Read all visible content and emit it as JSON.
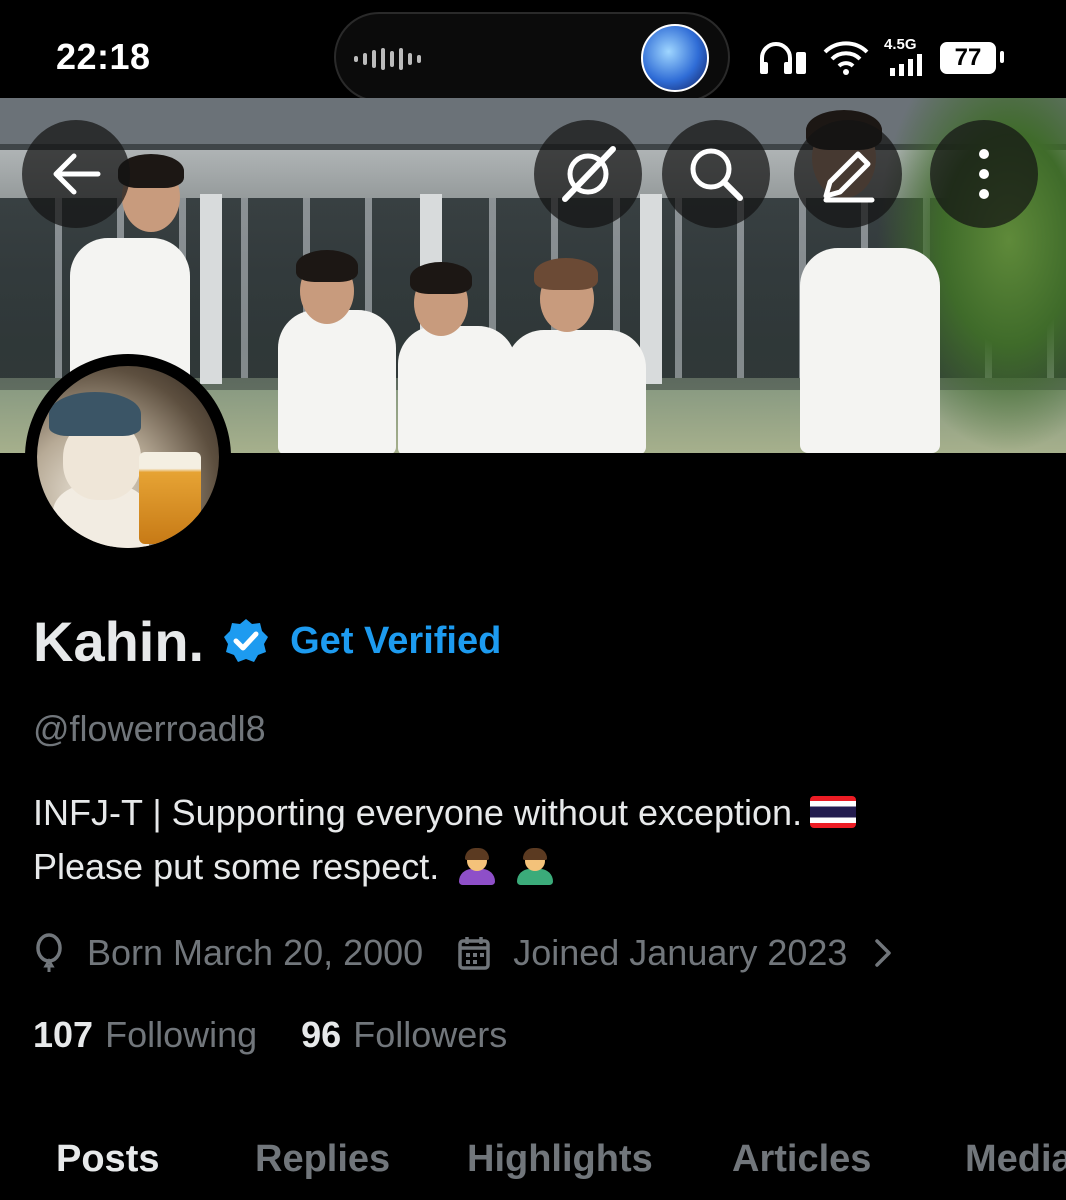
{
  "status_bar": {
    "time": "22:18",
    "network_label": "4.5G",
    "battery_level": "77",
    "icons": [
      "audio-waveform-icon",
      "app-avatar-icon",
      "headphones-icon",
      "wifi-icon",
      "cellular-signal-icon",
      "battery-icon"
    ]
  },
  "header_actions": {
    "back_icon": "arrow-left-icon",
    "grok_icon": "slash-circle-icon",
    "search_icon": "search-icon",
    "edit_icon": "pencil-icon",
    "more_icon": "more-vertical-icon"
  },
  "profile": {
    "display_name": "Kahin.",
    "verified_badge_icon": "verified-badge-icon",
    "get_verified_label": "Get Verified",
    "handle": "@flowerroadl8",
    "bio_line1": "INFJ-T | Supporting everyone without exception.",
    "bio_line2": "Please put some respect.",
    "bio_emojis": [
      "thailand-flag",
      "woman-bowing",
      "man-bowing"
    ],
    "birthday": "Born March 20, 2000",
    "joined": "Joined January 2023",
    "following_count": "107",
    "following_label": "Following",
    "followers_count": "96",
    "followers_label": "Followers"
  },
  "tabs": [
    {
      "label": "Posts",
      "active": true
    },
    {
      "label": "Replies",
      "active": false
    },
    {
      "label": "Highlights",
      "active": false
    },
    {
      "label": "Articles",
      "active": false
    },
    {
      "label": "Media",
      "active": false
    }
  ],
  "colors": {
    "background": "#000000",
    "primary_text": "#e7e9ea",
    "secondary_text": "#71767b",
    "accent_blue": "#1d9bf0"
  }
}
